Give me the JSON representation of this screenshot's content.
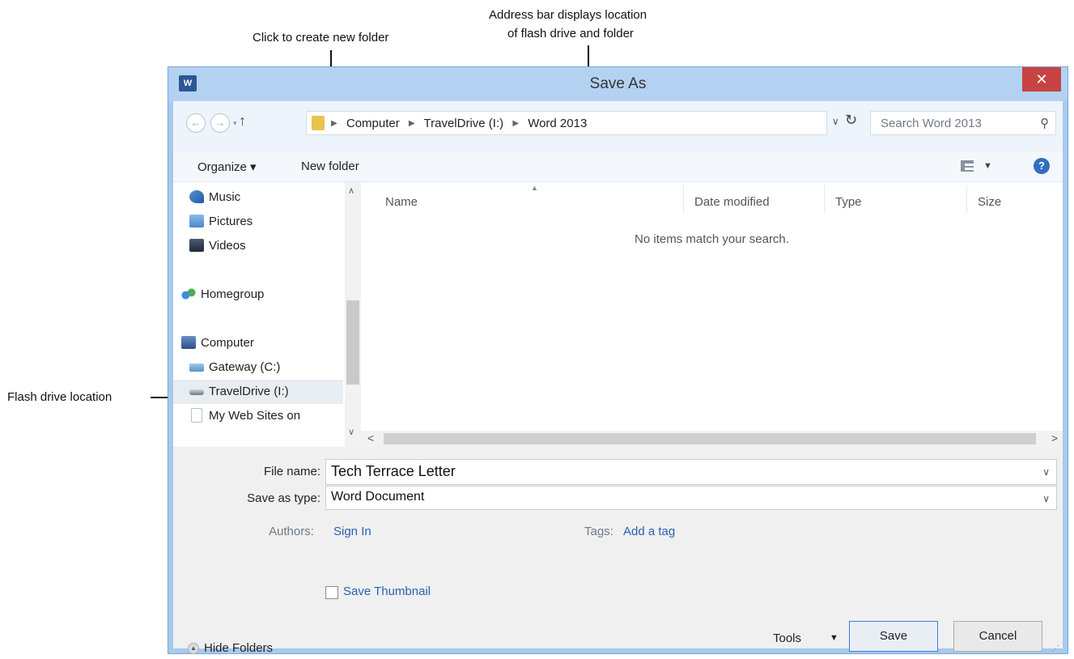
{
  "callouts": {
    "new_folder": "Click to create new folder",
    "address_line1": "Address bar displays location",
    "address_line2": "of flash drive and folder",
    "flash_drive": "Flash drive location"
  },
  "window": {
    "title": "Save As",
    "app_icon": "W",
    "close": "✕"
  },
  "nav": {
    "back_icon": "back-arrow-icon",
    "forward_icon": "forward-arrow-icon",
    "recent_icon": "chevron-down-icon",
    "up_icon": "up-arrow-icon",
    "breadcrumbs": [
      "Computer",
      "TravelDrive (I:)",
      "Word 2013"
    ],
    "search_placeholder": "Search Word 2013"
  },
  "toolbar": {
    "organize_label": "Organize ▾",
    "new_folder_label": "New folder"
  },
  "navpane": {
    "items": [
      {
        "label": "Music",
        "icon": "music-icon"
      },
      {
        "label": "Pictures",
        "icon": "pictures-icon"
      },
      {
        "label": "Videos",
        "icon": "videos-icon"
      },
      {
        "label": "Homegroup",
        "icon": "homegroup-icon"
      },
      {
        "label": "Computer",
        "icon": "computer-icon"
      },
      {
        "label": "Gateway (C:)",
        "icon": "drive-icon"
      },
      {
        "label": "TravelDrive (I:)",
        "icon": "usb-drive-icon",
        "selected": true
      },
      {
        "label": "My Web Sites on",
        "icon": "web-sites-icon"
      }
    ]
  },
  "filelist": {
    "columns": [
      "Name",
      "Date modified",
      "Type",
      "Size"
    ],
    "empty_message": "No items match your search."
  },
  "form": {
    "file_name_label": "File name:",
    "file_name_value": "Tech Terrace Letter",
    "save_type_label": "Save as type:",
    "save_type_value": "Word Document",
    "authors_label": "Authors:",
    "authors_value": "Sign In",
    "tags_label": "Tags:",
    "tags_value": "Add a tag",
    "thumbnail_label": "Save Thumbnail",
    "thumbnail_checked": false
  },
  "footer": {
    "hide_folders": "Hide Folders",
    "tools": "Tools",
    "save": "Save",
    "cancel": "Cancel"
  },
  "colors": {
    "title_bar": "#b3d2f2",
    "close_button": "#c74343",
    "link": "#2763b0"
  }
}
